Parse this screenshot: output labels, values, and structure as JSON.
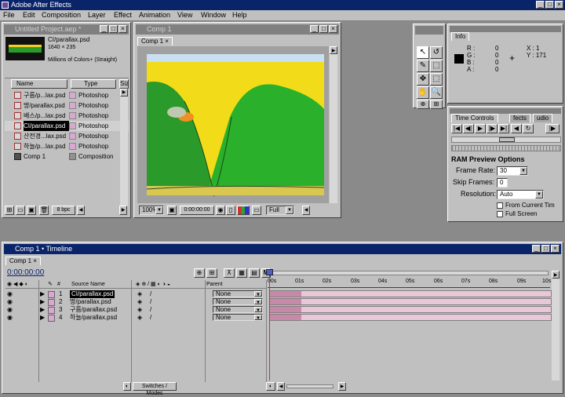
{
  "app": {
    "title": "Adobe After Effects"
  },
  "menu": [
    "File",
    "Edit",
    "Composition",
    "Layer",
    "Effect",
    "Animation",
    "View",
    "Window",
    "Help"
  ],
  "project": {
    "title": "Untitled Project.aep *",
    "selected_name": "CI/parallax.psd",
    "selected_size": "1640 × 235",
    "selected_color": "Millions of Colors+ (Straight)",
    "col_name": "Name",
    "col_type": "Type",
    "col_size": "Siz",
    "items": [
      {
        "name": "구름/p...lax.psd",
        "type": "Photoshop"
      },
      {
        "name": "땅/parallax.psd",
        "type": "Photoshop"
      },
      {
        "name": "배스/p...lax.psd",
        "type": "Photoshop"
      },
      {
        "name": "CI/parallax.psd",
        "type": "Photoshop"
      },
      {
        "name": "산전경...lax.psd",
        "type": "Photoshop"
      },
      {
        "name": "하늘/p...lax.psd",
        "type": "Photoshop"
      },
      {
        "name": "Comp 1",
        "type": "Composition"
      }
    ],
    "bpc": "8 bpc"
  },
  "comp": {
    "title": "Comp 1",
    "tab": "Comp 1",
    "zoom": "100%",
    "timecode": "0:00:00:00",
    "resolution": "Full"
  },
  "info": {
    "tab": "Info",
    "r": "R :",
    "g": "G :",
    "b": "B :",
    "a": "A :",
    "rv": "0",
    "gv": "0",
    "bv": "0",
    "av": "0",
    "x": "X : 1",
    "y": "Y : 171"
  },
  "time_controls": {
    "tab": "Time Controls",
    "tab2": "fects",
    "tab3": "udio",
    "ram_title": "RAM Preview Options",
    "frame_rate_label": "Frame Rate:",
    "frame_rate_value": "30",
    "skip_label": "Skip Frames:",
    "skip_value": "0",
    "resolution_label": "Resolution:",
    "resolution_value": "Auto",
    "from_current": "From Current Tim",
    "full_screen": "Full Screen"
  },
  "timeline": {
    "title": "Comp 1 • Timeline",
    "tab": "Comp 1",
    "timecode": "0:00:00:00",
    "col_source": "Source Name",
    "col_parent": "Parent",
    "switches_modes": "Switches / Modes",
    "ticks": [
      "00s",
      "01s",
      "02s",
      "03s",
      "04s",
      "05s",
      "06s",
      "07s",
      "08s",
      "09s",
      "10s"
    ],
    "layers": [
      {
        "num": "1",
        "name": "CI/parallax.psd",
        "parent": "None"
      },
      {
        "num": "2",
        "name": "땅/parallax.psd",
        "parent": "None"
      },
      {
        "num": "3",
        "name": "구름/parallax.psd",
        "parent": "None"
      },
      {
        "num": "4",
        "name": "하늘/parallax.psd",
        "parent": "None"
      }
    ]
  }
}
